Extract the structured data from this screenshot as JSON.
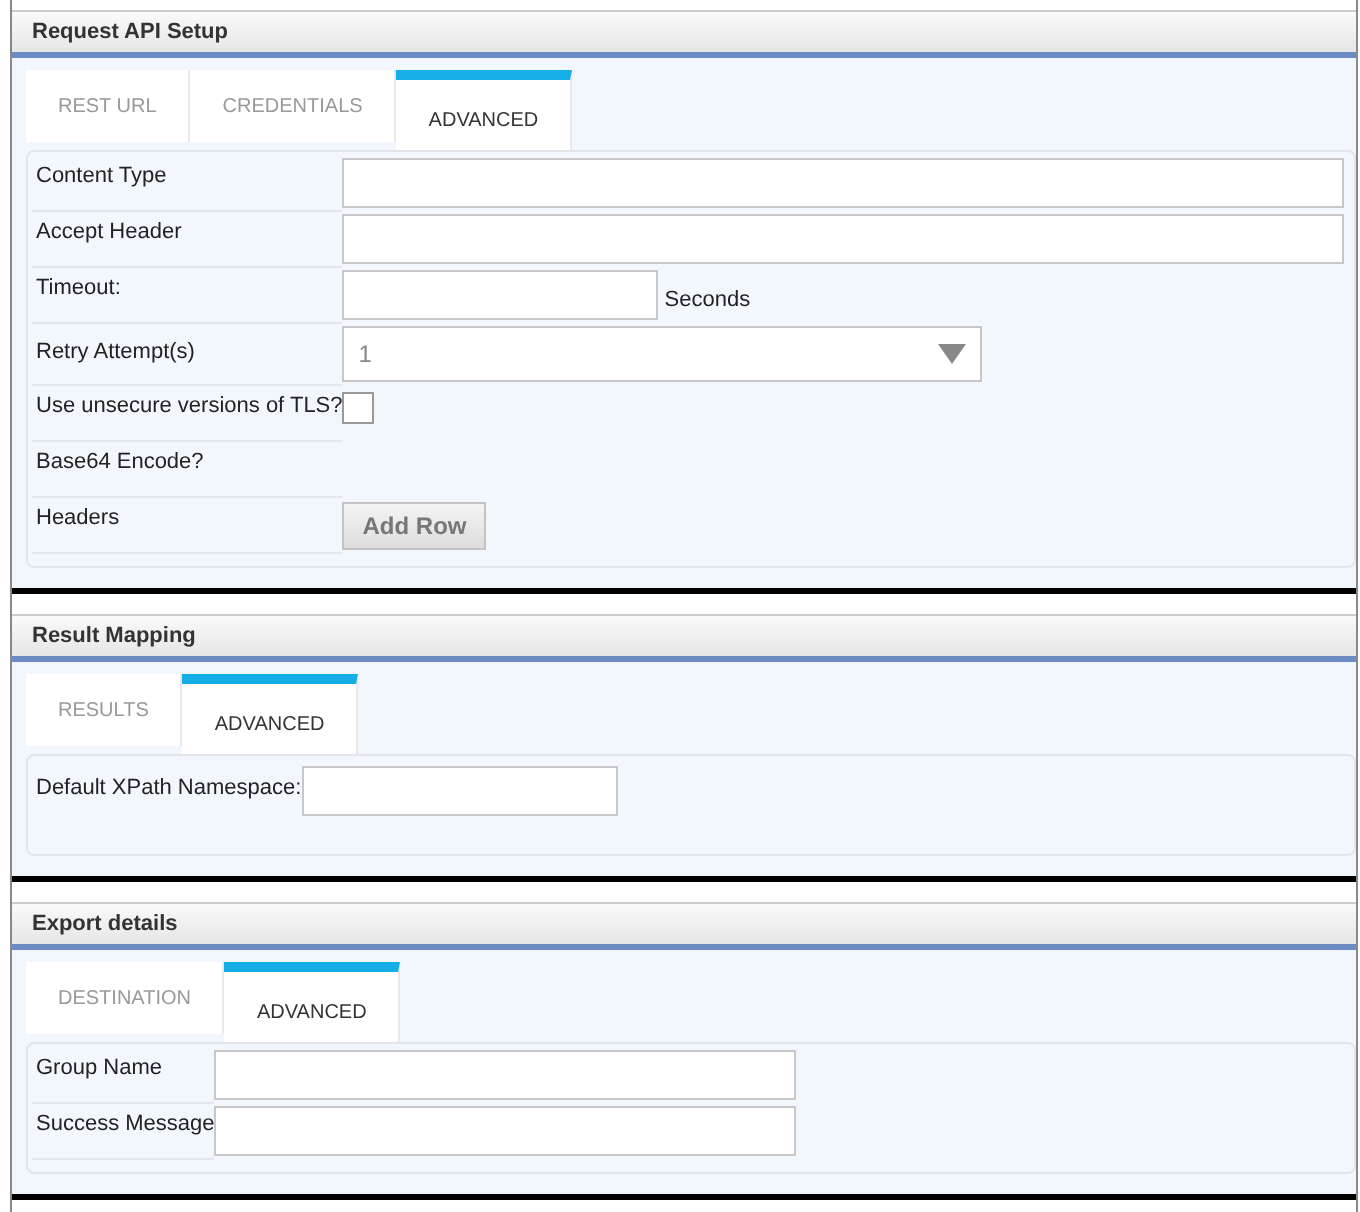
{
  "sections": [
    {
      "title": "Request API Setup",
      "tabs": [
        {
          "label": "REST URL",
          "selected": false
        },
        {
          "label": "CREDENTIALS",
          "selected": false
        },
        {
          "label": "ADVANCED",
          "selected": true
        }
      ],
      "fields": [
        {
          "kind": "text",
          "label": "Content Type"
        },
        {
          "kind": "text",
          "label": "Accept Header"
        },
        {
          "kind": "number",
          "label": "Timeout:",
          "suffix": "Seconds"
        },
        {
          "kind": "select",
          "label": "Retry Attempt(s)",
          "value": "1"
        },
        {
          "kind": "checkbox",
          "label": "Use unsecure versions of TLS?",
          "checked": false
        },
        {
          "kind": "empty",
          "label": "Base64 Encode?"
        },
        {
          "kind": "button",
          "label": "Headers",
          "button": "Add Row"
        }
      ]
    },
    {
      "title": "Result Mapping",
      "tabs": [
        {
          "label": "RESULTS",
          "selected": false
        },
        {
          "label": "ADVANCED",
          "selected": true
        }
      ],
      "fields": [
        {
          "kind": "compact",
          "label": "Default XPath Namespace:"
        }
      ]
    },
    {
      "title": "Export details",
      "tabs": [
        {
          "label": "DESTINATION",
          "selected": false
        },
        {
          "label": "ADVANCED",
          "selected": true
        }
      ],
      "fields": [
        {
          "kind": "short",
          "label": "Group Name"
        },
        {
          "kind": "short",
          "label": "Success Message"
        }
      ]
    }
  ]
}
